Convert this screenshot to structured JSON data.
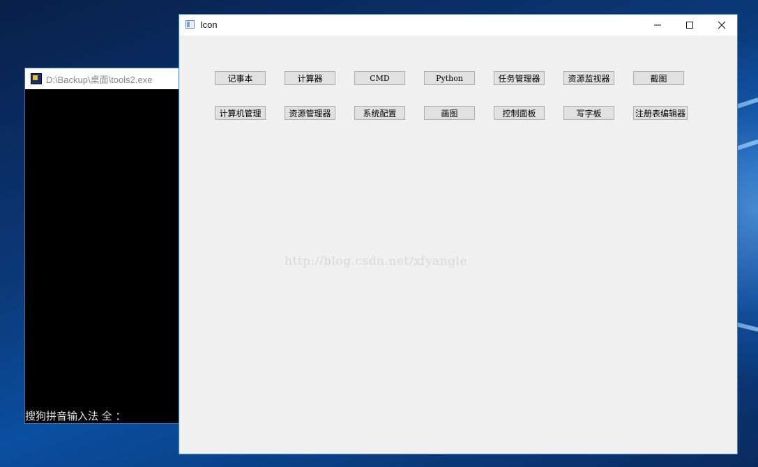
{
  "console": {
    "title": "D:\\Backup\\桌面\\tools2.exe",
    "ime_status": "搜狗拼音输入法 全 ："
  },
  "window": {
    "title": "Icon",
    "controls": {
      "minimize_icon": "minimize-icon",
      "maximize_icon": "maximize-icon",
      "close_icon": "close-icon"
    }
  },
  "buttons": {
    "row1": [
      "记事本",
      "计算器",
      "CMD",
      "Python",
      "任务管理器",
      "资源监视器",
      "截图"
    ],
    "row2": [
      "计算机管理",
      "资源管理器",
      "系统配置",
      "画图",
      "控制面板",
      "写字板",
      "注册表编辑器"
    ]
  },
  "watermark": "http://blog.csdn.net/xfyangle",
  "colors": {
    "window_bg": "#f0f0f0",
    "button_bg": "#e1e1e1",
    "button_border": "#adadad",
    "window_border": "#3c7fd0",
    "console_bg": "#000000"
  }
}
